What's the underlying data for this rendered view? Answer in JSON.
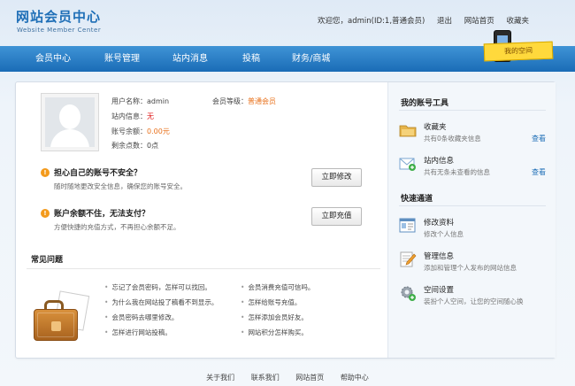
{
  "logo": {
    "title": "网站会员中心",
    "subtitle": "Website Member Center"
  },
  "toplinks": {
    "welcome": "欢迎您，admin(ID:1,普通会员)",
    "logout": "退出",
    "home": "网站首页",
    "favorites": "收藏夹"
  },
  "badge": {
    "label": "我的空间"
  },
  "nav": [
    "会员中心",
    "账号管理",
    "站内消息",
    "投稿",
    "财务/商城"
  ],
  "profile": {
    "username_label": "用户名称：",
    "username": "admin",
    "level_label": "会员等级：",
    "level": "普通会员",
    "messages_label": "站内信息：",
    "messages": "无",
    "balance_label": "账号余额：",
    "balance": "0.00元",
    "points_label": "剩余点数：",
    "points": "0点"
  },
  "alerts": [
    {
      "title": "担心自己的账号不安全？",
      "desc": "随时随地更改安全信息，确保您的账号安全。",
      "button": "立即修改"
    },
    {
      "title": "账户余额不住，无法支付？",
      "desc": "方便快捷的充值方式，不再担心余额不足。",
      "button": "立即充值"
    }
  ],
  "faq": {
    "title": "常见问题",
    "left": [
      "忘记了会员密码，怎样可以找回。",
      "为什么我在网站投了稿看不到显示。",
      "会员密码去哪里修改。",
      "怎样进行网站投稿。"
    ],
    "right": [
      "会员消费充值可信吗。",
      "怎样给账号充值。",
      "怎样添加会员好友。",
      "网站积分怎样购买。"
    ]
  },
  "sidebar": {
    "tools_title": "我的账号工具",
    "tools": [
      {
        "name": "收藏夹",
        "desc": "共有0条收藏夹信息",
        "link": "查看",
        "icon": "folder-icon"
      },
      {
        "name": "站内信息",
        "desc": "共有无条未查看的信息",
        "link": "查看",
        "icon": "mail-icon"
      }
    ],
    "quick_title": "快速通道",
    "quick": [
      {
        "name": "修改资料",
        "desc": "修改个人信息",
        "icon": "profile-icon"
      },
      {
        "name": "管理信息",
        "desc": "添加和管理个人发布的网站信息",
        "icon": "edit-icon"
      },
      {
        "name": "空间设置",
        "desc": "装扮个人空间，让您的空间随心换",
        "icon": "gear-icon"
      }
    ]
  },
  "footer": [
    "关于我们",
    "联系我们",
    "网站首页",
    "帮助中心"
  ],
  "colors": {
    "brand": "#1f6fb7",
    "nav": "#2a7cc4",
    "accent": "#e8701a",
    "warning": "#f39a1c"
  }
}
